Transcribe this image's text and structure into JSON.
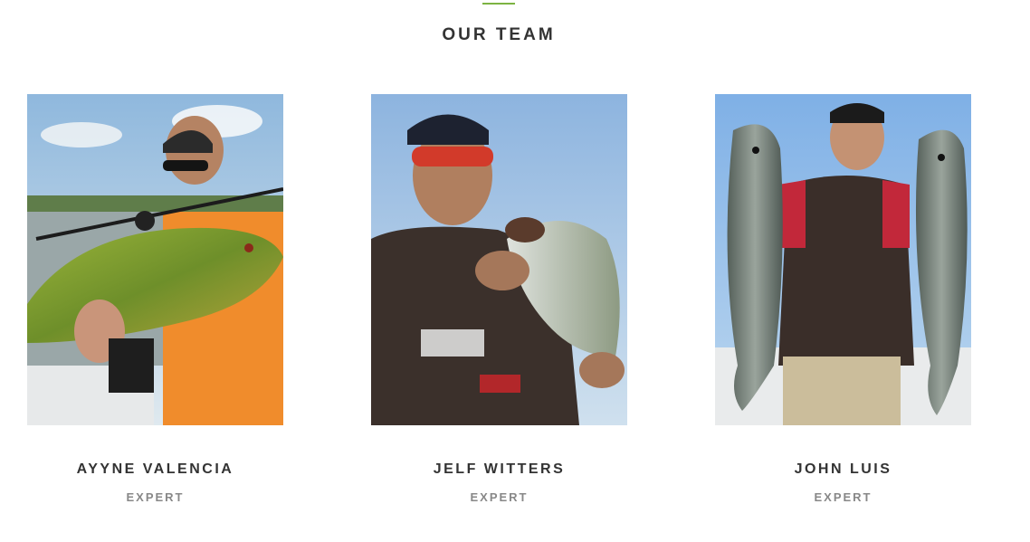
{
  "section": {
    "title": "OUR TEAM",
    "accent_color": "#7cb342"
  },
  "team": [
    {
      "name": "AYYNE VALENCIA",
      "role": "EXPERT",
      "photo": "angler-holding-peacock-bass-photo"
    },
    {
      "name": "JELF WITTERS",
      "role": "EXPERT",
      "photo": "angler-holding-bass-photo"
    },
    {
      "name": "JOHN LUIS",
      "role": "EXPERT",
      "photo": "angler-holding-two-sea-bass-photo"
    }
  ]
}
